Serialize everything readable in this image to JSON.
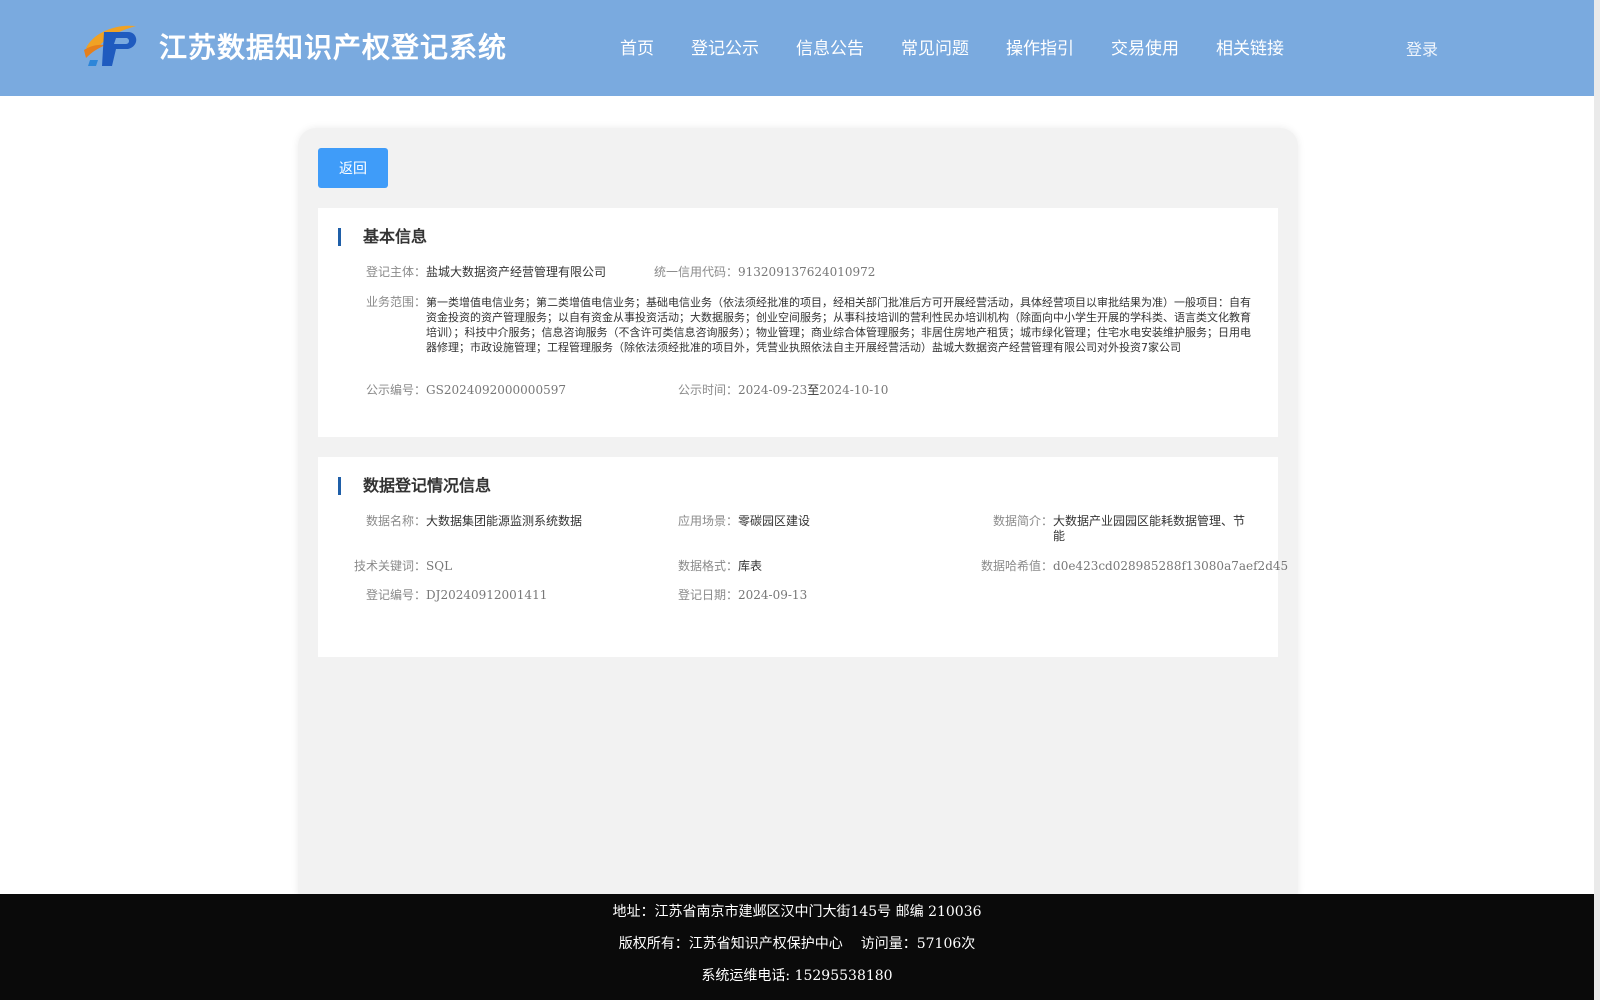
{
  "header": {
    "title": "江苏数据知识产权登记系统",
    "nav": [
      "首页",
      "登记公示",
      "信息公告",
      "常见问题",
      "操作指引",
      "交易使用",
      "相关链接"
    ],
    "login": "登录"
  },
  "back_label": "返回",
  "basic": {
    "title": "基本信息",
    "subject_label": "登记主体：",
    "subject": "盐城大数据资产经营管理有限公司",
    "credit_label": "统一信用代码：",
    "credit": "913209137624010972",
    "scope_label": "业务范围：",
    "scope": "第一类增值电信业务；第二类增值电信业务；基础电信业务（依法须经批准的项目，经相关部门批准后方可开展经营活动，具体经营项目以审批结果为准）一般项目：自有资金投资的资产管理服务；以自有资金从事投资活动；大数据服务；创业空间服务；从事科技培训的营利性民办培训机构（除面向中小学生开展的学科类、语言类文化教育培训）；科技中介服务；信息咨询服务（不含许可类信息咨询服务）；物业管理；商业综合体管理服务；非居住房地产租赁；城市绿化管理；住宅水电安装维护服务；日用电器修理；市政设施管理；工程管理服务（除依法须经批准的项目外，凭营业执照依法自主开展经营活动）盐城大数据资产经营管理有限公司对外投资7家公司",
    "pub_no_label": "公示编号：",
    "pub_no": "GS2024092000000597",
    "pub_time_label": "公示时间：",
    "pub_start": "2024-09-23",
    "pub_to": "至",
    "pub_end": "2024-10-10"
  },
  "data_info": {
    "title": "数据登记情况信息",
    "name_label": "数据名称：",
    "name": "大数据集团能源监测系统数据",
    "scene_label": "应用场景：",
    "scene": "零碳园区建设",
    "intro_label": "数据简介：",
    "intro": "大数据产业园园区能耗数据管理、节能",
    "keyword_label": "技术关键词：",
    "keyword": "SQL",
    "format_label": "数据格式：",
    "format": "库表",
    "hash_label": "数据哈希值：",
    "hash": "d0e423cd028985288f13080a7aef2d45",
    "reg_no_label": "登记编号：",
    "reg_no": "DJ20240912001411",
    "reg_date_label": "登记日期：",
    "reg_date": "2024-09-13"
  },
  "footer": {
    "address": "地址：江苏省南京市建邺区汉中门大街145号 邮编 210036",
    "copyright": "版权所有：江苏省知识产权保护中心",
    "visits": "访问量：57106次",
    "phone": "系统运维电话: 15295538180"
  },
  "colors": {
    "header_bg": "#7aaadf",
    "button_bg": "#3f9cf9",
    "accent_bar": "#1f5fa8",
    "footer_bg": "#0a0a0a"
  }
}
